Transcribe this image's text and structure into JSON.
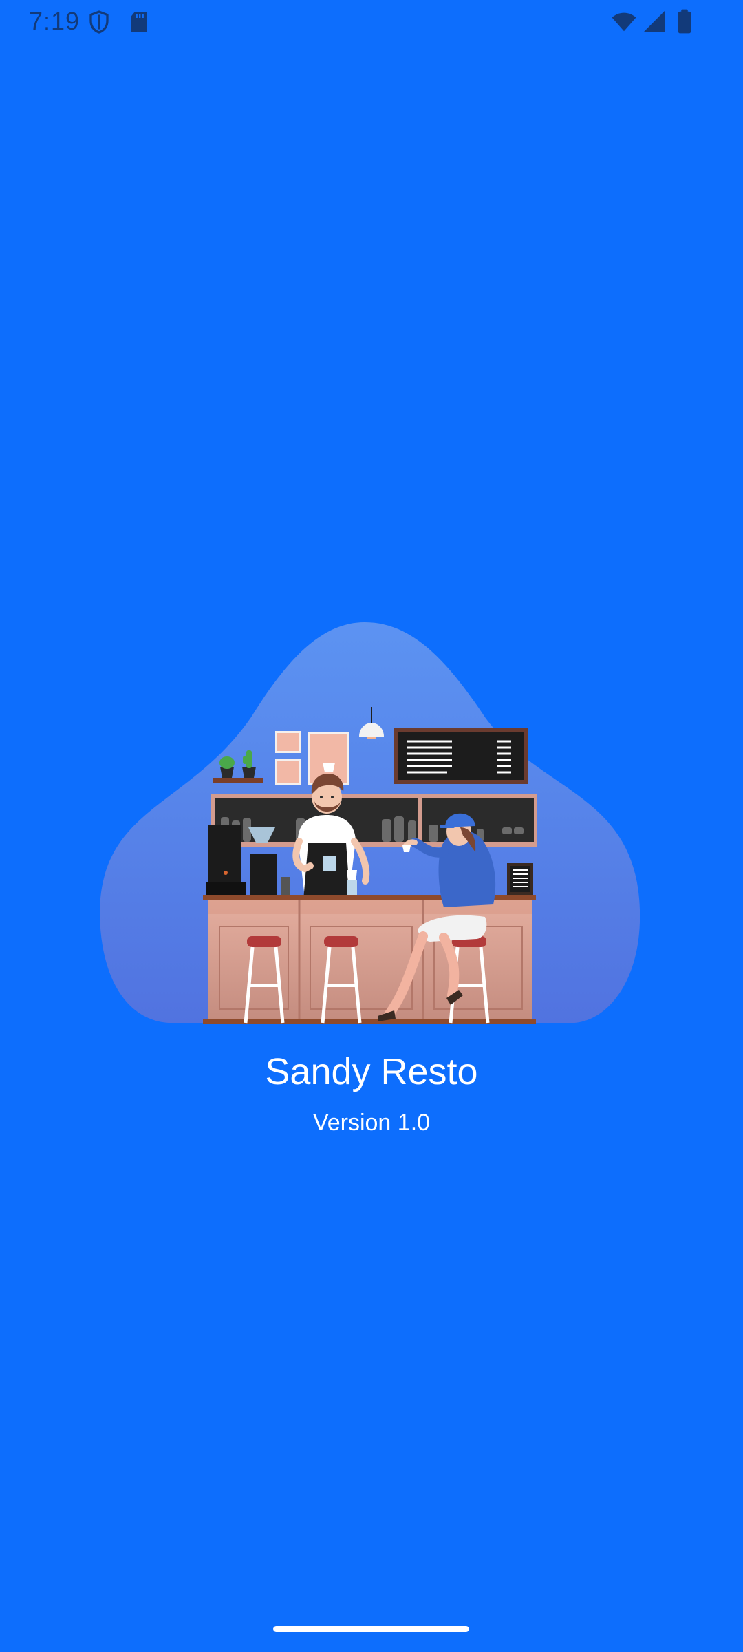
{
  "status_bar": {
    "time": "7:19",
    "left_icons": [
      "shield-icon",
      "sd-card-icon"
    ],
    "right_icons": [
      "wifi-icon",
      "signal-icon",
      "battery-icon"
    ]
  },
  "splash": {
    "app_name": "Sandy Resto",
    "version": "Version 1.0"
  },
  "colors": {
    "background": "#0D6EFD",
    "text": "#FFFFFF",
    "blob": "#5A86EE"
  }
}
